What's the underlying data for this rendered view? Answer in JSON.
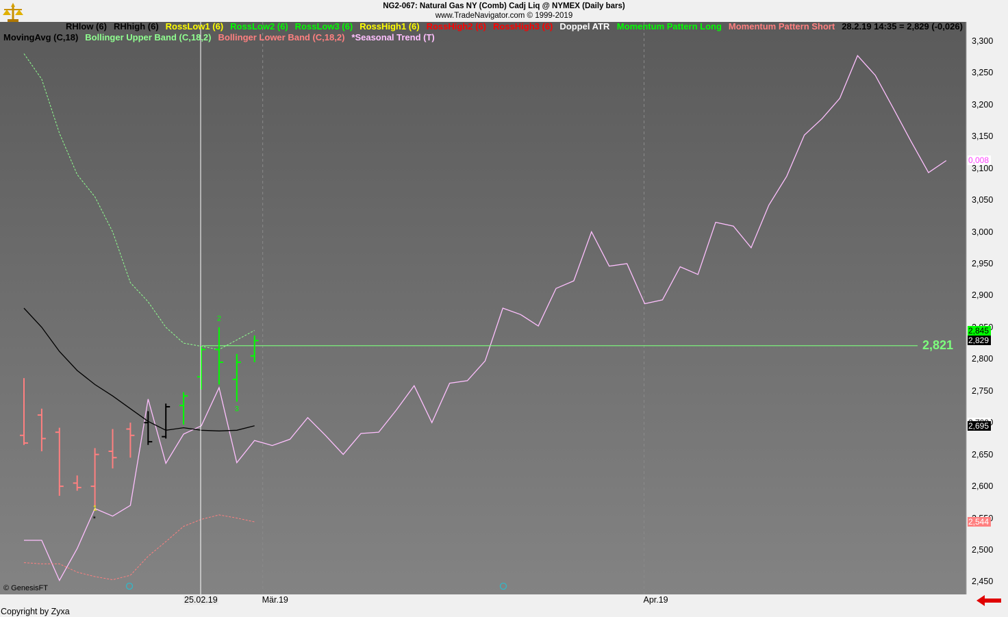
{
  "header": {
    "line1": "NG2-067:  Natural Gas NY (Comb) Cadj Liq @ NYMEX  (Daily bars)",
    "line2": "www.TradeNavigator.com © 1999-2019"
  },
  "legend_row1": [
    {
      "text": "RHlow (6)",
      "color": "#000000"
    },
    {
      "text": "RHhigh (6)",
      "color": "#000000"
    },
    {
      "text": "RossLow1 (6)",
      "color": "#ffff00"
    },
    {
      "text": "RossLow2 (6)",
      "color": "#00ff00"
    },
    {
      "text": "RossLow3 (6)",
      "color": "#00ff00"
    },
    {
      "text": "RossHigh1 (6)",
      "color": "#ffff00"
    },
    {
      "text": "RossHigh2 (6)",
      "color": "#ff0000"
    },
    {
      "text": "RossHigh3 (6)",
      "color": "#ff0000"
    },
    {
      "text": "Doppel ATR",
      "color": "#ffffff"
    },
    {
      "text": "Momentum Pattern Long",
      "color": "#00ff00"
    },
    {
      "text": "Momentum Pattern Short",
      "color": "#ff8080"
    },
    {
      "text": "28.2.19 14:35 = 2,829 (-0,026)",
      "color": "#000000"
    }
  ],
  "legend_row2": [
    {
      "text": "MovingAvg (C,18)",
      "color": "#000000"
    },
    {
      "text": "Bollinger Upper Band (C,18,2)",
      "color": "#90ff90"
    },
    {
      "text": "Bollinger Lower Band (C,18,2)",
      "color": "#ff8080"
    },
    {
      "text": "*Seasonal Trend (T)",
      "color": "#ffc0ff"
    }
  ],
  "footer": {
    "copyright": "Copyright by Zyxa",
    "genesis": "© GenesisFT",
    "selected_date": "25.02.19"
  },
  "colors": {
    "bg_top": "#5a5a5a",
    "bg_bottom": "#838383",
    "bar_down": "#ff8080",
    "bar_up": "#00ff00",
    "bar_neutral": "#000000",
    "seasonal": "#ffc0ff",
    "moving_avg": "#000000",
    "bb_upper": "#90ff90",
    "bb_lower": "#ff8080",
    "hline": "#7dff7d"
  },
  "chart_data": {
    "type": "line",
    "title": "NG2-067:  Natural Gas NY (Comb) Cadj Liq @ NYMEX  (Daily bars)",
    "ylim": [
      2.43,
      3.33
    ],
    "y_ticks": [
      2.45,
      2.5,
      2.55,
      2.6,
      2.65,
      2.7,
      2.75,
      2.8,
      2.85,
      2.9,
      2.95,
      3.0,
      3.05,
      3.1,
      3.15,
      3.2,
      3.25,
      3.3
    ],
    "y_tick_labels": [
      "2,450",
      "2,500",
      "2,550",
      "2,600",
      "2,650",
      "2,700",
      "2,750",
      "2,800",
      "2,850",
      "2,900",
      "2,950",
      "3,000",
      "3,050",
      "3,100",
      "3,150",
      "3,200",
      "3,250",
      "3,300"
    ],
    "x_tick_labels": [
      {
        "label": "Mär.19",
        "index": 13.5
      },
      {
        "label": "Apr.19",
        "index": 35
      }
    ],
    "grid": true,
    "ohlc_bars": [
      {
        "i": 0,
        "o": 2.68,
        "h": 2.77,
        "l": 2.665,
        "c": 2.668,
        "dir": "down"
      },
      {
        "i": 1,
        "o": 2.712,
        "h": 2.722,
        "l": 2.655,
        "c": 2.675,
        "dir": "down"
      },
      {
        "i": 2,
        "o": 2.685,
        "h": 2.692,
        "l": 2.585,
        "c": 2.6,
        "dir": "down"
      },
      {
        "i": 3,
        "o": 2.605,
        "h": 2.617,
        "l": 2.593,
        "c": 2.598,
        "dir": "down"
      },
      {
        "i": 4,
        "o": 2.6,
        "h": 2.66,
        "l": 2.568,
        "c": 2.65,
        "dir": "down"
      },
      {
        "i": 5,
        "o": 2.655,
        "h": 2.69,
        "l": 2.628,
        "c": 2.645,
        "dir": "down"
      },
      {
        "i": 6,
        "o": 2.69,
        "h": 2.7,
        "l": 2.645,
        "c": 2.68,
        "dir": "down"
      },
      {
        "i": 7,
        "o": 2.7,
        "h": 2.718,
        "l": 2.665,
        "c": 2.67,
        "dir": "neutral"
      },
      {
        "i": 8,
        "o": 2.678,
        "h": 2.73,
        "l": 2.675,
        "c": 2.725,
        "dir": "neutral"
      },
      {
        "i": 9,
        "o": 2.727,
        "h": 2.748,
        "l": 2.697,
        "c": 2.742,
        "dir": "up"
      },
      {
        "i": 10,
        "o": 2.772,
        "h": 2.82,
        "l": 2.752,
        "c": 2.815,
        "dir": "up"
      },
      {
        "i": 11,
        "o": 2.815,
        "h": 2.85,
        "l": 2.76,
        "c": 2.795,
        "dir": "up"
      },
      {
        "i": 12,
        "o": 2.768,
        "h": 2.808,
        "l": 2.733,
        "c": 2.795,
        "dir": "up"
      },
      {
        "i": 13,
        "o": 2.805,
        "h": 2.837,
        "l": 2.795,
        "c": 2.829,
        "dir": "up"
      }
    ],
    "moving_avg": [
      [
        0,
        2.88
      ],
      [
        1,
        2.85
      ],
      [
        2,
        2.812
      ],
      [
        3,
        2.782
      ],
      [
        4,
        2.76
      ],
      [
        5,
        2.742
      ],
      [
        6,
        2.722
      ],
      [
        7,
        2.702
      ],
      [
        8,
        2.688
      ],
      [
        9,
        2.692
      ],
      [
        10,
        2.688
      ],
      [
        11,
        2.687
      ],
      [
        12,
        2.688
      ],
      [
        13,
        2.695
      ]
    ],
    "bb_upper": [
      [
        0,
        3.28
      ],
      [
        1,
        3.24
      ],
      [
        2,
        3.155
      ],
      [
        3,
        3.09
      ],
      [
        4,
        3.055
      ],
      [
        5,
        3.0
      ],
      [
        6,
        2.92
      ],
      [
        7,
        2.89
      ],
      [
        8,
        2.85
      ],
      [
        9,
        2.825
      ],
      [
        10,
        2.82
      ],
      [
        11,
        2.815
      ],
      [
        12,
        2.83
      ],
      [
        13,
        2.845
      ]
    ],
    "bb_lower": [
      [
        0,
        2.48
      ],
      [
        1,
        2.478
      ],
      [
        2,
        2.478
      ],
      [
        3,
        2.465
      ],
      [
        4,
        2.458
      ],
      [
        5,
        2.453
      ],
      [
        6,
        2.46
      ],
      [
        7,
        2.49
      ],
      [
        8,
        2.513
      ],
      [
        9,
        2.537
      ],
      [
        10,
        2.548
      ],
      [
        11,
        2.555
      ],
      [
        12,
        2.55
      ],
      [
        13,
        2.544
      ]
    ],
    "seasonal_trend": [
      [
        0,
        2.515
      ],
      [
        1,
        2.515
      ],
      [
        2,
        2.452
      ],
      [
        3,
        2.502
      ],
      [
        4,
        2.565
      ],
      [
        5,
        2.553
      ],
      [
        6,
        2.57
      ],
      [
        7,
        2.737
      ],
      [
        8,
        2.636
      ],
      [
        9,
        2.682
      ],
      [
        10,
        2.695
      ],
      [
        11,
        2.755
      ],
      [
        12,
        2.637
      ],
      [
        13,
        2.672
      ],
      [
        14,
        2.664
      ],
      [
        15,
        2.674
      ],
      [
        16,
        2.708
      ],
      [
        17,
        2.68
      ],
      [
        18,
        2.65
      ],
      [
        19,
        2.683
      ],
      [
        20,
        2.685
      ],
      [
        21,
        2.72
      ],
      [
        22,
        2.758
      ],
      [
        23,
        2.7
      ],
      [
        24,
        2.762
      ],
      [
        25,
        2.766
      ],
      [
        26,
        2.797
      ],
      [
        27,
        2.88
      ],
      [
        28,
        2.87
      ],
      [
        29,
        2.852
      ],
      [
        30,
        2.911
      ],
      [
        31,
        2.923
      ],
      [
        32,
        3.0
      ],
      [
        33,
        2.946
      ],
      [
        34,
        2.95
      ],
      [
        35,
        2.887
      ],
      [
        36,
        2.893
      ],
      [
        37,
        2.945
      ],
      [
        38,
        2.933
      ],
      [
        39,
        3.015
      ],
      [
        40,
        3.009
      ],
      [
        41,
        2.975
      ],
      [
        42,
        3.042
      ],
      [
        43,
        3.087
      ],
      [
        44,
        3.152
      ],
      [
        45,
        3.178
      ],
      [
        46,
        3.21
      ],
      [
        47,
        3.277
      ],
      [
        48,
        3.246
      ],
      [
        49,
        3.195
      ],
      [
        50,
        3.143
      ],
      [
        51,
        3.093
      ],
      [
        52,
        3.112
      ]
    ],
    "horizontal_line": {
      "value": 2.821,
      "label": "2,821"
    },
    "price_badges": [
      {
        "value": 2.845,
        "label": "2,845",
        "bg": "#00ff00",
        "fg": "#000000"
      },
      {
        "value": 2.829,
        "label": "2,829",
        "bg": "#000000",
        "fg": "#ffffff"
      },
      {
        "value": 2.7,
        "label": "2,700",
        "bg": "#ffffff",
        "fg": "#000000"
      },
      {
        "value": 2.695,
        "label": "2,695",
        "bg": "#000000",
        "fg": "#ffffff"
      },
      {
        "value": 2.544,
        "label": "2,544",
        "bg": "#ff8080",
        "fg": "#ffffff"
      },
      {
        "value": 3.113,
        "label": "0,008",
        "bg": "#ffffff",
        "fg": "#ff40ff"
      }
    ],
    "annotations": [
      {
        "text": "1",
        "i": 4,
        "value": 2.562,
        "color": "#ffff00"
      },
      {
        "text": "*",
        "i": 4,
        "value": 2.545,
        "color": "#000000"
      },
      {
        "text": "2",
        "i": 11,
        "value": 2.86,
        "color": "#00ff00"
      },
      {
        "text": "3",
        "i": 12,
        "value": 2.718,
        "color": "#00ff00"
      }
    ]
  }
}
